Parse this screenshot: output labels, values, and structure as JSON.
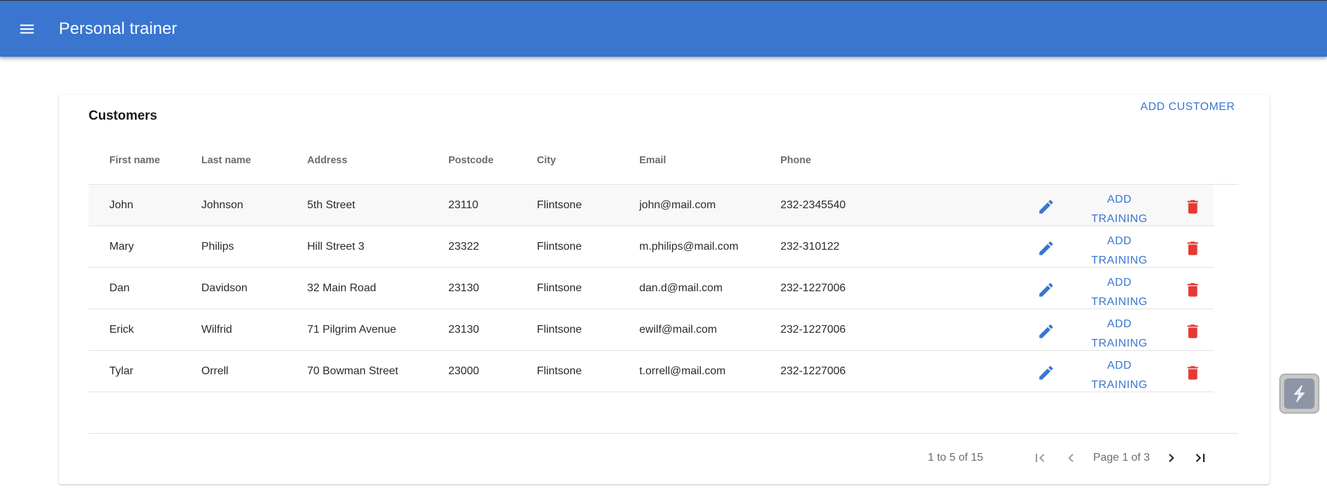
{
  "app": {
    "title": "Personal trainer",
    "menu_icon": "menu-icon"
  },
  "card": {
    "title": "Customers",
    "add_customer_label": "ADD CUSTOMER"
  },
  "table": {
    "columns": [
      "First name",
      "Last name",
      "Address",
      "Postcode",
      "City",
      "Email",
      "Phone"
    ],
    "rows": [
      {
        "first": "John",
        "last": "Johnson",
        "address": "5th Street",
        "postcode": "23110",
        "city": "Flintsone",
        "email": "john@mail.com",
        "phone": "232-2345540"
      },
      {
        "first": "Mary",
        "last": "Philips",
        "address": "Hill Street 3",
        "postcode": "23322",
        "city": "Flintsone",
        "email": "m.philips@mail.com",
        "phone": "232-310122"
      },
      {
        "first": "Dan",
        "last": "Davidson",
        "address": "32 Main Road",
        "postcode": "23130",
        "city": "Flintsone",
        "email": "dan.d@mail.com",
        "phone": "232-1227006"
      },
      {
        "first": "Erick",
        "last": "Wilfrid",
        "address": "71 Pilgrim Avenue",
        "postcode": "23130",
        "city": "Flintsone",
        "email": "ewilf@mail.com",
        "phone": "232-1227006"
      },
      {
        "first": "Tylar",
        "last": "Orrell",
        "address": "70 Bowman Street",
        "postcode": "23000",
        "city": "Flintsone",
        "email": "t.orrell@mail.com",
        "phone": "232-1227006"
      }
    ],
    "row_actions": {
      "add_training_label": "ADD TRAINING",
      "edit_icon": "pencil-icon",
      "delete_icon": "trash-icon"
    }
  },
  "pagination": {
    "summary": "1 to 5 of 15",
    "page_label": "Page 1 of 3",
    "icons": [
      "first-page-icon",
      "previous-page-icon",
      "next-page-icon",
      "last-page-icon"
    ]
  },
  "colors": {
    "primary": "#3a75d0",
    "danger": "#e53935",
    "text": "#2a2a2a",
    "muted": "#6b6b6b"
  }
}
